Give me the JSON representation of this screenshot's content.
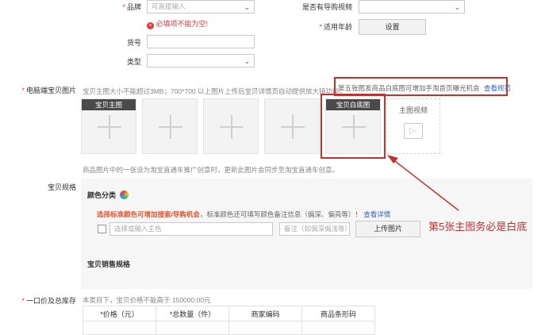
{
  "form": {
    "brand": {
      "label": "品牌",
      "placeholder": "可直接输入"
    },
    "error_text": "必填项不能为空!",
    "video_guide": {
      "label": "是否有导购视频"
    },
    "age": {
      "label": "适用年龄",
      "button": "设置"
    },
    "item_no": {
      "label": "货号"
    },
    "type": {
      "label": "类型"
    }
  },
  "images": {
    "label": "电脑端宝贝图片",
    "hint": "宝贝主图大小不能超过3MB；700*700 以上图片上传后宝贝详情页自动提供放大镜功能。",
    "promo": "第五张图发商品白底图可增加手淘首页曝光机会",
    "promo_link": "查看规范",
    "main_tag": "宝贝主图",
    "white_tag": "宝贝白底图",
    "video_label": "主图视频",
    "sub_hint": "商品图片中的一张设为淘宝直通车推广创意时，更新此图片会同步至淘宝直通车创意。"
  },
  "sku": {
    "label": "宝贝规格",
    "color_title": "颜色分类",
    "color_promo": "选择标准颜色可增加搜索/导购机会",
    "color_promo_rest": "，标准颜色还可填写颜色备注信息（偏深、偏亮等）！",
    "color_link": "查看详情",
    "color_placeholder": "选择或输入主色",
    "remark_placeholder": "备注（如偏深偏浅等）",
    "upload_button": "上传图片",
    "sales_title": "宝贝销售规格"
  },
  "price": {
    "label": "一口价及总库存",
    "hint": "本类目下，宝贝价格不能高于 150000.00元",
    "columns": [
      "*价格（元）",
      "*总数量（件）",
      "商家编码",
      "商品条形码"
    ]
  },
  "annotation": {
    "text": "第5张主图务必是白底"
  },
  "colors": {
    "annotation_red": "#c9302c",
    "link_blue": "#3366cc",
    "promo_orange": "#e4572e"
  }
}
